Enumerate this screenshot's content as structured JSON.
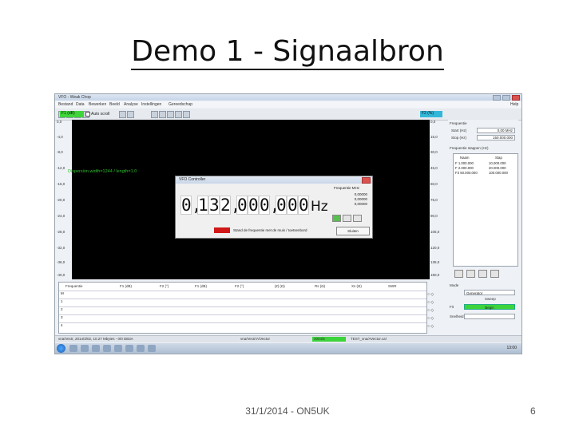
{
  "slide": {
    "title": "Demo 1 - Signaalbron",
    "footer_date": "31/1/2014 - ON5UK",
    "page_number": "6"
  },
  "app": {
    "window_title": "VFO - Weak Chop",
    "menu": [
      "Bestand",
      "Data",
      "Bewerken",
      "Beeld",
      "Analyse",
      "Instellingen",
      "Gereedschap",
      "Help"
    ],
    "left_tag": "F1 (dB)",
    "auto_scroll_label": "Auto scroll",
    "right_tag": "F2 (%)",
    "left_axis_ticks": [
      "0,0",
      "-4,0",
      "-8,0",
      "-12,0",
      "-16,0",
      "-20,0",
      "-24,0",
      "-28,0",
      "-32,0",
      "-36,0",
      "-40,0"
    ],
    "right_axis_ticks": [
      "0,0",
      "15,0",
      "30,0",
      "45,0",
      "60,0",
      "75,0",
      "90,0",
      "105,0",
      "120,0",
      "135,0",
      "150,0"
    ],
    "trace_label": "Dispersion width=1244 / length=1.0",
    "dialog": {
      "title": "VFO Controller",
      "freq_digits": [
        "0",
        "1",
        "3",
        "2",
        "0",
        "0",
        "0",
        "0",
        "0",
        "0"
      ],
      "unit": "Hz",
      "side_title": "Frequentie MHz",
      "side_values": [
        "0,00000",
        "0,00000",
        "0,00000"
      ],
      "status_text": "Stand de frequentie met de muis / toetsenbord",
      "ok_label": "Sluiten"
    },
    "right_panel": {
      "group1": "Frequentie",
      "start_label": "Start (Hz)",
      "start_value": "0,00 MHz",
      "stop_label": "Stop (Hz)",
      "stop_value": "150.000.000",
      "group2": "Frequentie stappen (Hz)",
      "list_headers": [
        "Naam",
        "Stap"
      ],
      "list_rows": [
        [
          "F 1.000.000",
          "10,000.000"
        ],
        [
          "F 2.000.000",
          "20.000.000"
        ],
        [
          "F3 50.000.000",
          "100.000.000"
        ]
      ]
    },
    "table": {
      "headers": [
        "Frequentie",
        "F1 (dB)",
        "F2 (°)",
        "F1 (dB)",
        "F2 (°)",
        "|Z| (Ω)",
        "Rs (Ω)",
        "Xs (Ω)",
        "SWR"
      ],
      "rows": [
        "M",
        "1",
        "2",
        "3",
        "4"
      ]
    },
    "mode_panel": {
      "mode_label": "Mode",
      "mode_value": "Generator",
      "field_label": "Sweep",
      "fit_label": "Fit",
      "green_label": "Begin",
      "speed_label": "Snelheid"
    },
    "statusbar": {
      "left": "vna/Vectr, 2014/3/02, 10.27 Mbytes - 0/0 DB3A",
      "mid": "vna/Vectr/A/Vector",
      "green": "2004/5",
      "right": "TEST_vna/AVector.cal"
    },
    "clock": "13:00"
  }
}
